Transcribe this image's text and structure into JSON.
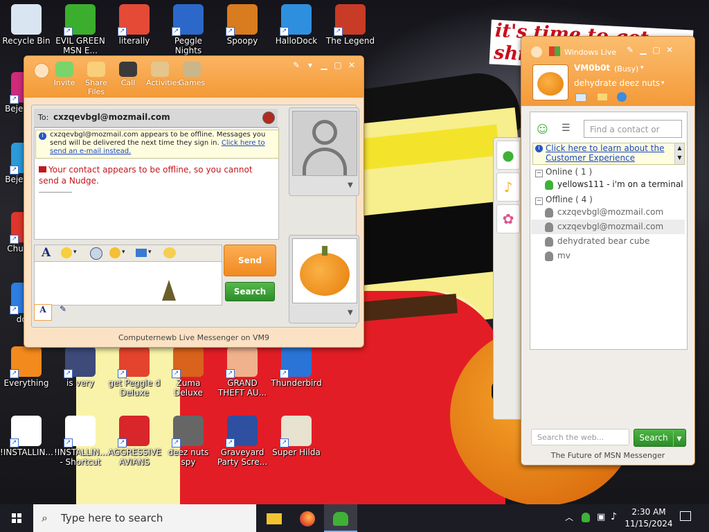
{
  "desktop": {
    "wallpaper_caption": "it's time to get shit and or t",
    "icons": [
      {
        "label": "Recycle Bin",
        "icon": "recycle-bin-icon",
        "color": "#d9e6f2"
      },
      {
        "label": "EVIL GREEN MSN E...",
        "icon": "msn-buddies-icon",
        "color": "#3cae2e"
      },
      {
        "label": "literally",
        "icon": "chrome-icon",
        "color": "#e44a35"
      },
      {
        "label": "Peggle Nights",
        "icon": "peggle-icon",
        "color": "#2b68c9"
      },
      {
        "label": "Spoopy",
        "icon": "book-icon",
        "color": "#d97b1f"
      },
      {
        "label": "HalloDock",
        "icon": "windows-logo-icon",
        "color": "#2f8fdf"
      },
      {
        "label": "The Legend",
        "icon": "game-character-icon",
        "color": "#c83b26"
      },
      {
        "label": "Bejeweled",
        "icon": "bejeweled-icon",
        "color": "#d02a7a"
      },
      {
        "label": "Beje... Del",
        "icon": "bejeweled-icon",
        "color": "#2b9ad8"
      },
      {
        "label": "Chu... De",
        "icon": "chuzzle-icon",
        "color": "#e0352b"
      },
      {
        "label": "does",
        "icon": "blue-bird-icon",
        "color": "#2e7de0"
      },
      {
        "label": "Everything",
        "icon": "magnifier-icon",
        "color": "#f28a1e"
      },
      {
        "label": "is very",
        "icon": "shield-logo-icon",
        "color": "#3d4a7a"
      },
      {
        "label": "get Peggle d Deluxe",
        "icon": "peggle-icon",
        "color": "#e4432d"
      },
      {
        "label": "Zuma Deluxe",
        "icon": "zuma-icon",
        "color": "#d9621c"
      },
      {
        "label": "GRAND THEFT AU...",
        "icon": "anime-girl-icon",
        "color": "#f0b28c"
      },
      {
        "label": "Thunderbird",
        "icon": "thunderbird-icon",
        "color": "#2a74d8"
      },
      {
        "label": "!INSTALLIN...",
        "icon": "text-file-icon",
        "color": "#ffffff"
      },
      {
        "label": "!INSTALLIN... - Shortcut",
        "icon": "text-file-icon",
        "color": "#ffffff"
      },
      {
        "label": "AGGRESSIVE AVIANS",
        "icon": "angry-bird-icon",
        "color": "#d8262a"
      },
      {
        "label": "deez nuts spy",
        "icon": "window-stack-icon",
        "color": "#666666"
      },
      {
        "label": "Graveyard Party Scre...",
        "icon": "voted-sticker-icon",
        "color": "#2f4fa0"
      },
      {
        "label": "Super Hilda",
        "icon": "pixel-dog-icon",
        "color": "#e8e2d0"
      }
    ]
  },
  "conversation": {
    "toolbar": [
      {
        "label": "Invite",
        "icon": "invite-icon",
        "color": "#7ad36b"
      },
      {
        "label": "Share Files",
        "icon": "folder-icon",
        "color": "#f9d07a"
      },
      {
        "label": "Call",
        "icon": "phone-icon",
        "color": "#3a3a3a"
      },
      {
        "label": "Activities",
        "icon": "activities-icon",
        "color": "#e5c58c"
      },
      {
        "label": "Games",
        "icon": "games-icon",
        "color": "#c9b68a"
      }
    ],
    "to_label": "To:",
    "to_address": "cxzqevbgl@mozmail.com",
    "info_text": "cxzqevbgl@mozmail.com appears to be offline. Messages you send will be delivered the next time they sign in.",
    "info_link": "Click here to send an e-mail instead.",
    "nudge_error": "Your contact appears to be offline, so you cannot send a Nudge.",
    "send_label": "Send",
    "search_label": "Search",
    "footer": "Computernewb Live Messenger on VM9"
  },
  "main": {
    "brand": "Windows Live",
    "display_name": "VM0b0t",
    "status": "(Busy)",
    "personal_message": "dehydrate deez nuts",
    "search_placeholder": "Find a contact or number...",
    "promo_link": "Click here to learn about the Customer Experience",
    "online_group": "Online ( 1 )",
    "offline_group": "Offline ( 4 )",
    "online_contacts": [
      {
        "name": "yellows111 - i'm on a terminal"
      }
    ],
    "offline_contacts": [
      {
        "name": "cxzqevbgl@mozmail.com"
      },
      {
        "name": "cxzqevbgl@mozmail.com"
      },
      {
        "name": "dehydrated bear cube"
      },
      {
        "name": "mv"
      }
    ],
    "web_search_placeholder": "Search the web...",
    "search_label": "Search",
    "footer": "The Future of MSN Messenger"
  },
  "taskbar": {
    "search_placeholder": "Type here to search",
    "time": "2:30 AM",
    "date": "11/15/2024"
  },
  "colors": {
    "msn_orange": "#f39a36",
    "online_green": "#3fb137",
    "offline_grey": "#8a8a8a",
    "error_red": "#c3161c"
  }
}
